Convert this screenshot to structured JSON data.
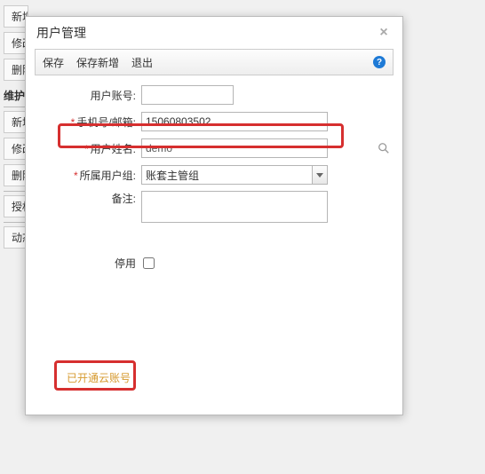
{
  "bg": {
    "b1": "新增",
    "b2": "修改",
    "b3": "删除",
    "label1": "维护",
    "b4": "新增",
    "b5": "修改",
    "b6": "删除",
    "b7": "授权",
    "b8": "动态"
  },
  "modal": {
    "title": "用户管理",
    "close": "×"
  },
  "toolbar": {
    "save": "保存",
    "saveNew": "保存新增",
    "exit": "退出",
    "help": "?"
  },
  "form": {
    "account": {
      "label": "用户账号:",
      "value": ""
    },
    "phone": {
      "label": "手机号/邮箱:",
      "value": "15060803502"
    },
    "username": {
      "label": "用户姓名:",
      "value": "demo"
    },
    "group": {
      "label": "所属用户组:",
      "value": "账套主管组"
    },
    "remark": {
      "label": "备注:",
      "value": ""
    },
    "disabled": {
      "label": "停用"
    }
  },
  "status": {
    "label": "已开通云账号"
  }
}
